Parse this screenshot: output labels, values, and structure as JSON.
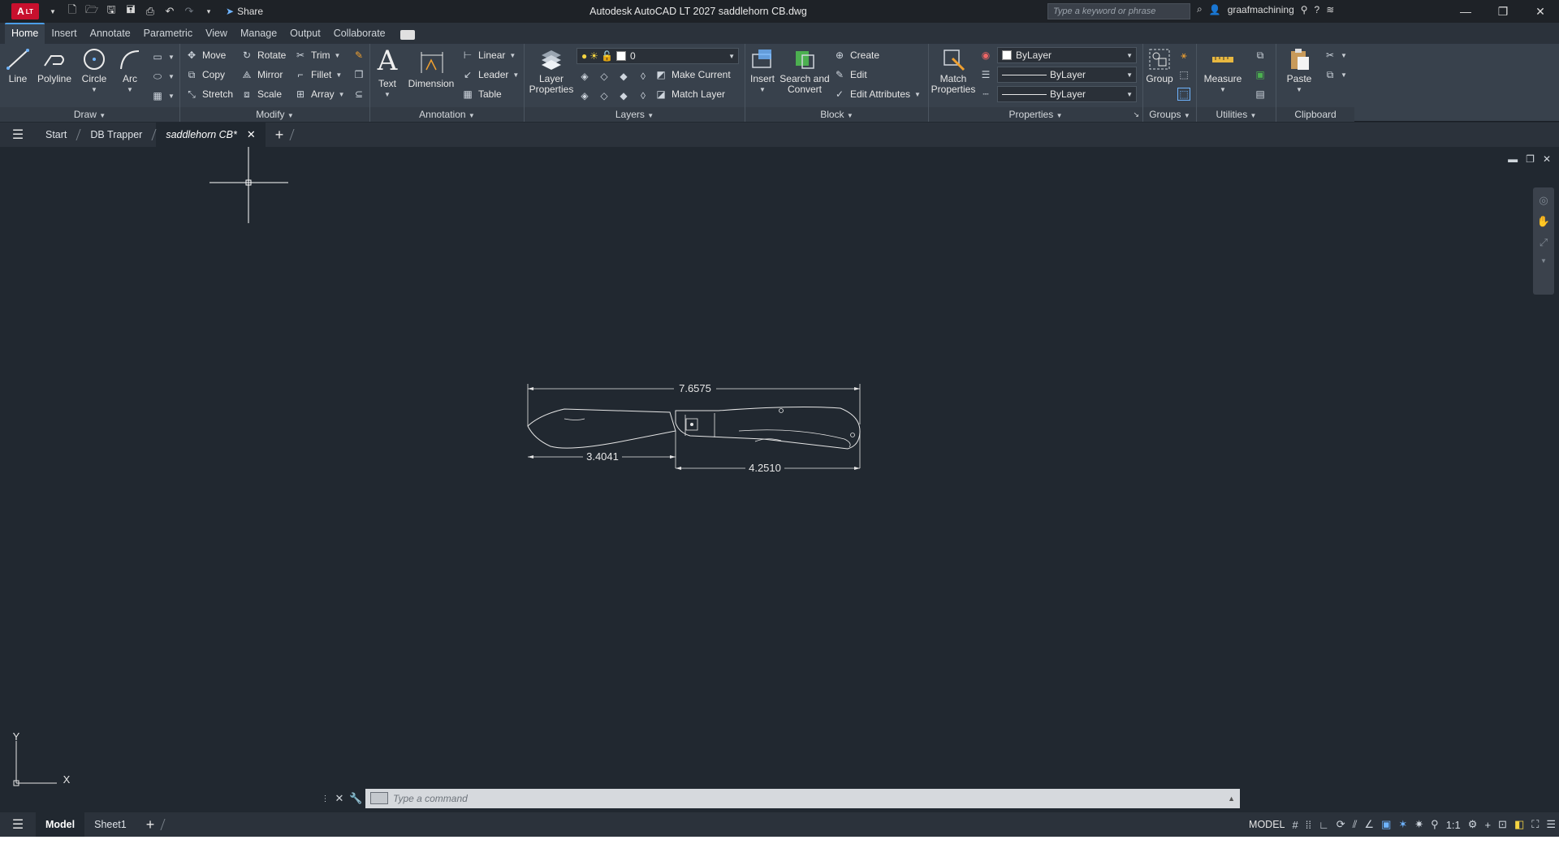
{
  "app": {
    "logo_text": "A",
    "logo_sub": "LT",
    "title": "Autodesk AutoCAD LT 2027   saddlehorn CB.dwg",
    "share_label": "Share",
    "search_placeholder": "Type a keyword or phrase",
    "user": "graafmachining"
  },
  "ribbon_tabs": [
    "Home",
    "Insert",
    "Annotate",
    "Parametric",
    "View",
    "Manage",
    "Output",
    "Collaborate"
  ],
  "draw": {
    "title": "Draw",
    "line": "Line",
    "polyline": "Polyline",
    "circle": "Circle",
    "arc": "Arc"
  },
  "modify": {
    "title": "Modify",
    "move": "Move",
    "rotate": "Rotate",
    "trim": "Trim",
    "copy": "Copy",
    "mirror": "Mirror",
    "fillet": "Fillet",
    "stretch": "Stretch",
    "scale": "Scale",
    "array": "Array"
  },
  "annotation": {
    "title": "Annotation",
    "text": "Text",
    "dimension": "Dimension",
    "linear": "Linear",
    "leader": "Leader",
    "table": "Table"
  },
  "layers": {
    "title": "Layers",
    "layer_properties_1": "Layer",
    "layer_properties_2": "Properties",
    "current_layer": "0",
    "make_current": "Make Current",
    "match_layer": "Match Layer"
  },
  "block": {
    "title": "Block",
    "insert": "Insert",
    "search_1": "Search and",
    "search_2": "Convert",
    "create": "Create",
    "edit": "Edit",
    "edit_attributes": "Edit Attributes"
  },
  "properties": {
    "title": "Properties",
    "match_1": "Match",
    "match_2": "Properties",
    "color": "ByLayer",
    "linetype": "ByLayer",
    "lineweight": "ByLayer"
  },
  "groups": {
    "title": "Groups",
    "group": "Group"
  },
  "utilities": {
    "title": "Utilities",
    "measure": "Measure"
  },
  "clipboard": {
    "title": "Clipboard",
    "paste": "Paste"
  },
  "file_tabs": [
    "Start",
    "DB Trapper",
    "saddlehorn CB*"
  ],
  "drawing": {
    "dim_overall": "7.6575",
    "dim_blade": "3.4041",
    "dim_handle": "4.2510"
  },
  "ucs": {
    "x": "X",
    "y": "Y"
  },
  "command": {
    "placeholder": "Type a command"
  },
  "layout_tabs": [
    "Model",
    "Sheet1"
  ],
  "status": {
    "model": "MODEL",
    "scale": "1:1"
  }
}
